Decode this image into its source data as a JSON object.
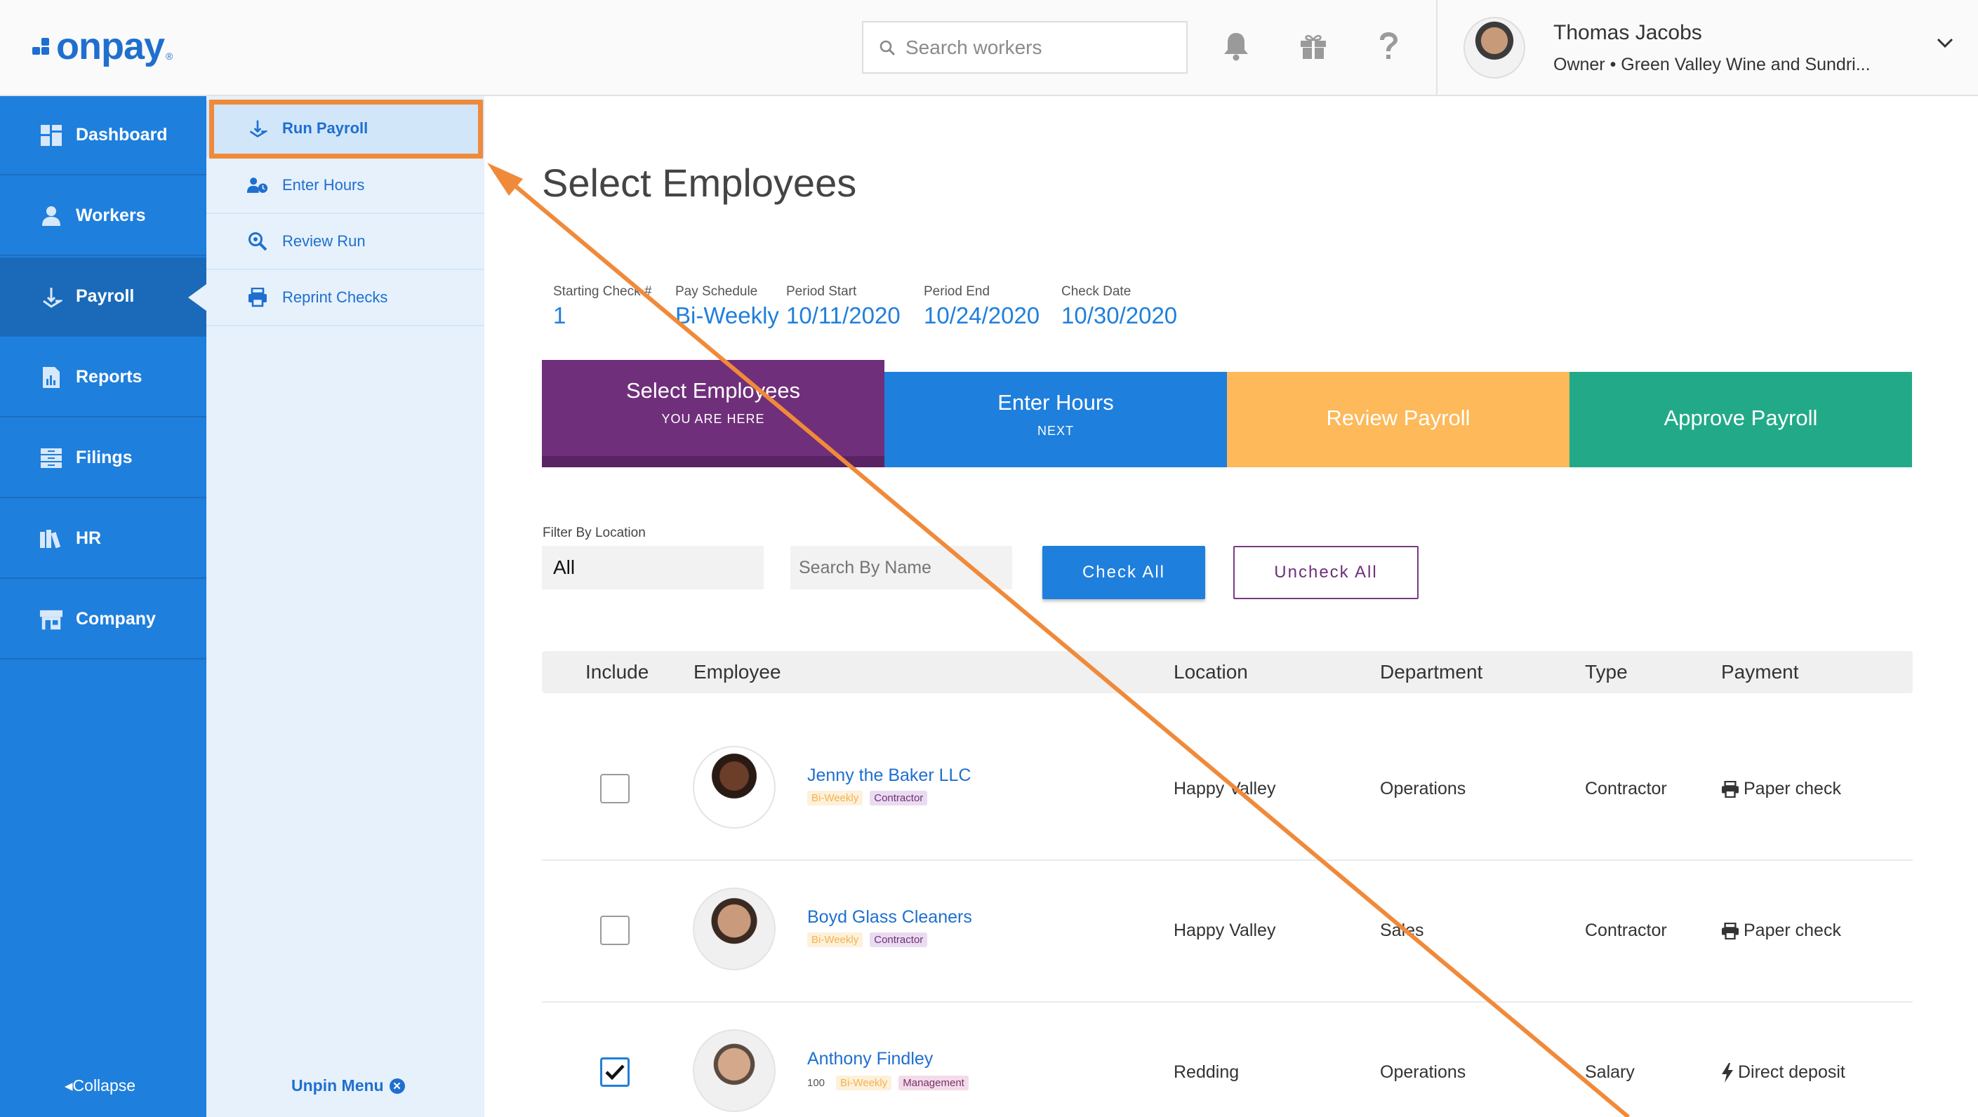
{
  "brand": {
    "logo_text": "onpay",
    "logo_mark": "®"
  },
  "header": {
    "search_placeholder": "Search workers",
    "user_name": "Thomas Jacobs",
    "user_role": "Owner • Green Valley Wine and Sundri..."
  },
  "sidebar": {
    "items": [
      {
        "label": "Dashboard",
        "icon": "dashboard-grid-icon"
      },
      {
        "label": "Workers",
        "icon": "workers-icon"
      },
      {
        "label": "Payroll",
        "icon": "payroll-icon"
      },
      {
        "label": "Reports",
        "icon": "reports-icon"
      },
      {
        "label": "Filings",
        "icon": "filings-icon"
      },
      {
        "label": "HR",
        "icon": "hr-books-icon"
      },
      {
        "label": "Company",
        "icon": "store-icon"
      }
    ],
    "collapse_label": "Collapse"
  },
  "submenu": {
    "items": [
      {
        "label": "Run Payroll"
      },
      {
        "label": "Enter Hours"
      },
      {
        "label": "Review Run"
      },
      {
        "label": "Reprint Checks"
      }
    ],
    "unpin_label": "Unpin Menu"
  },
  "main": {
    "title": "Select Employees",
    "meta": [
      {
        "label": "Starting Check #",
        "value": "1"
      },
      {
        "label": "Pay Schedule",
        "value": "Bi-Weekly"
      },
      {
        "label": "Period Start",
        "value": "10/11/2020"
      },
      {
        "label": "Period End",
        "value": "10/24/2020"
      },
      {
        "label": "Check Date",
        "value": "10/30/2020"
      }
    ],
    "steps": [
      {
        "label": "Select Employees",
        "sub": "YOU ARE HERE",
        "color": "#6f2f7a"
      },
      {
        "label": "Enter Hours",
        "sub": "NEXT",
        "color": "#1f7fdc"
      },
      {
        "label": "Review Payroll",
        "sub": "",
        "color": "#fdb95a"
      },
      {
        "label": "Approve Payroll",
        "sub": "",
        "color": "#22aa88"
      }
    ],
    "filter_label": "Filter By Location",
    "filter_value": "All",
    "search_name_placeholder": "Search By Name",
    "check_all": "Check All",
    "uncheck_all": "Uncheck All",
    "columns": [
      "Include",
      "Employee",
      "Location",
      "Department",
      "Type",
      "Payment"
    ],
    "rows": [
      {
        "name": "Jenny the Baker LLC",
        "number": "",
        "tags": [
          "Bi-Weekly",
          "Contractor"
        ],
        "location": "Happy Valley",
        "department": "Operations",
        "type": "Contractor",
        "payment": "Paper check",
        "payment_icon": "printer-icon",
        "checked": false
      },
      {
        "name": "Boyd Glass Cleaners",
        "number": "",
        "tags": [
          "Bi-Weekly",
          "Contractor"
        ],
        "location": "Happy Valley",
        "department": "Sales",
        "type": "Contractor",
        "payment": "Paper check",
        "payment_icon": "printer-icon",
        "checked": false
      },
      {
        "name": "Anthony Findley",
        "number": "100",
        "tags": [
          "Bi-Weekly",
          "Management"
        ],
        "location": "Redding",
        "department": "Operations",
        "type": "Salary",
        "payment": "Direct deposit",
        "payment_icon": "lightning-icon",
        "checked": true
      }
    ]
  },
  "annotation_color": "#f08a3a"
}
